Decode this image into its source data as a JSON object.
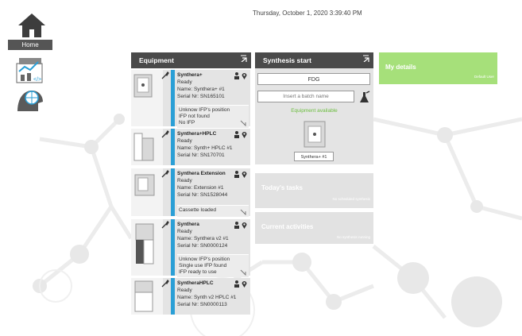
{
  "header": {
    "datetime": "Thursday, October 1, 2020 3:39:40 PM"
  },
  "nav": {
    "home_label": "Home",
    "items": [
      {
        "name": "home-icon"
      },
      {
        "name": "statistics-icon"
      },
      {
        "name": "support-icon"
      }
    ]
  },
  "equipment": {
    "title": "Equipment",
    "cards": [
      {
        "title": "Synthera+",
        "status": "Ready",
        "name": "Name: Synthera+ #1",
        "serial": "Serial Nr: SN165101",
        "note": [
          "Unknow  IFP's position",
          "IFP not found",
          "No IFP"
        ]
      },
      {
        "title": "Synthera+HPLC",
        "status": "Ready",
        "name": "Name: Synth+ HPLC #1",
        "serial": "Serial Nr: SN170701",
        "note": []
      },
      {
        "title": "Synthera Extension",
        "status": "Ready",
        "name": "Name: Extension #1",
        "serial": "Serial Nr: SN1528044",
        "note": [
          "Cassette loaded"
        ]
      },
      {
        "title": "Synthera",
        "status": "Ready",
        "name": "Name: Synthera v2 #1",
        "serial": "Serial Nr: SN0000124",
        "note": [
          "Unknow  IFP's position",
          "Single use IFP found",
          "IFP ready to use"
        ]
      },
      {
        "title": "SyntheraHPLC",
        "status": "Ready",
        "name": "Name: Synth v2 HPLC #1",
        "serial": "Serial Nr: SN0000113",
        "note": []
      }
    ]
  },
  "synthesis": {
    "title": "Synthesis start",
    "product": "FDG",
    "batch_placeholder": "Insert a batch name",
    "available": "Equipment available",
    "device": "Synthera+ #1"
  },
  "tasks": {
    "title": "Today's tasks",
    "sub": "No scheduled synthesis"
  },
  "activities": {
    "title": "Current activities",
    "sub": "No synthesis running"
  },
  "details": {
    "title": "My details",
    "sub": "Default User"
  },
  "colors": {
    "accent_blue": "#2a9fd6",
    "header_dark": "#4a4a4a",
    "green": "#a6e07a",
    "available_green": "#6bbd3e"
  }
}
